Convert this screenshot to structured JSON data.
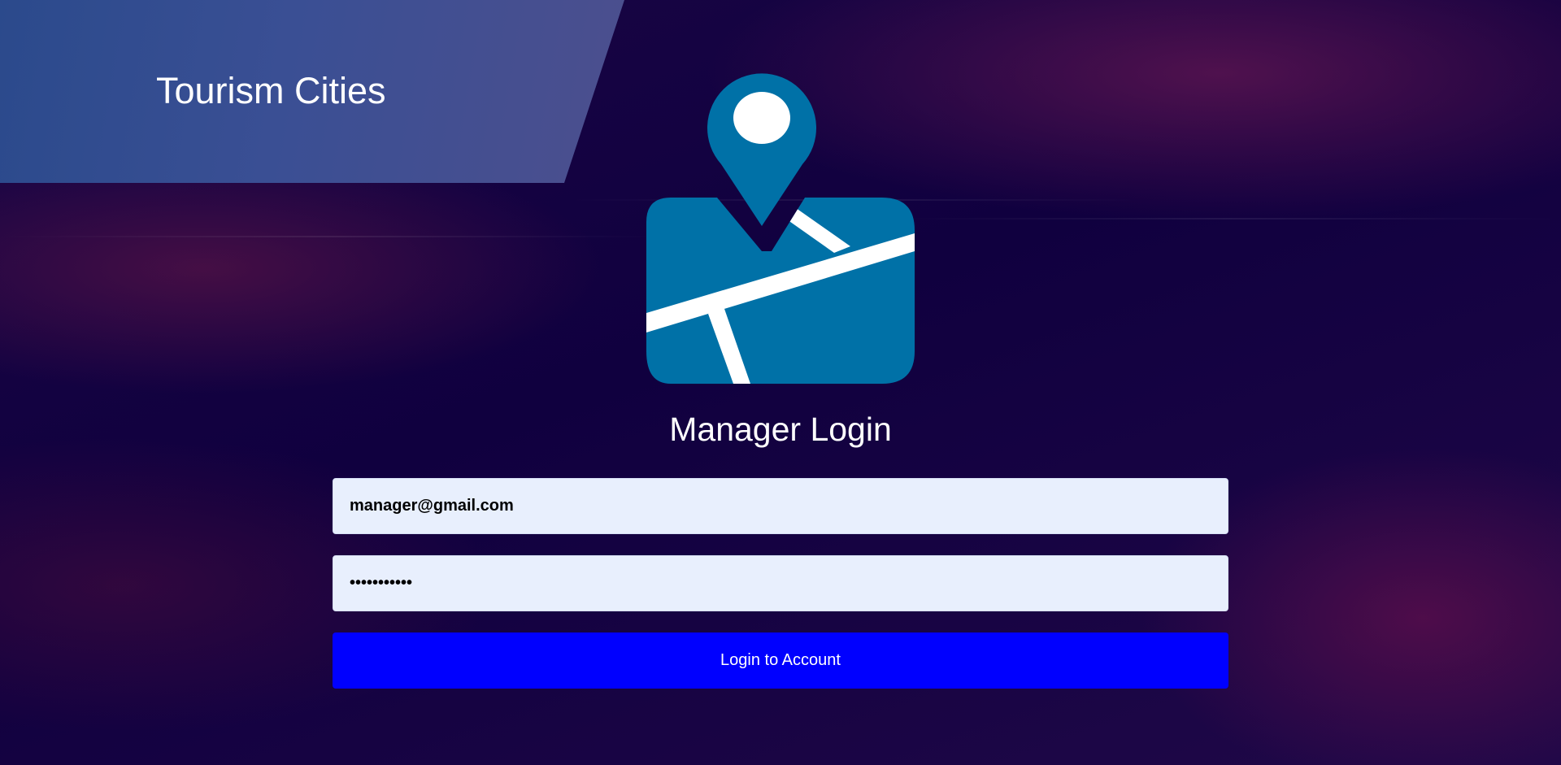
{
  "brand": {
    "title": "Tourism Cities"
  },
  "logo": {
    "icon": "map-pin-icon",
    "color": "#0071a7"
  },
  "login": {
    "heading": "Manager Login",
    "email_value": "manager@gmail.com",
    "password_value": "secretpassw",
    "submit_label": "Login to Account"
  },
  "colors": {
    "background": "#0e0040",
    "banner": "#3a4f94",
    "input_background": "#e8effd",
    "button": "#0000ff"
  }
}
